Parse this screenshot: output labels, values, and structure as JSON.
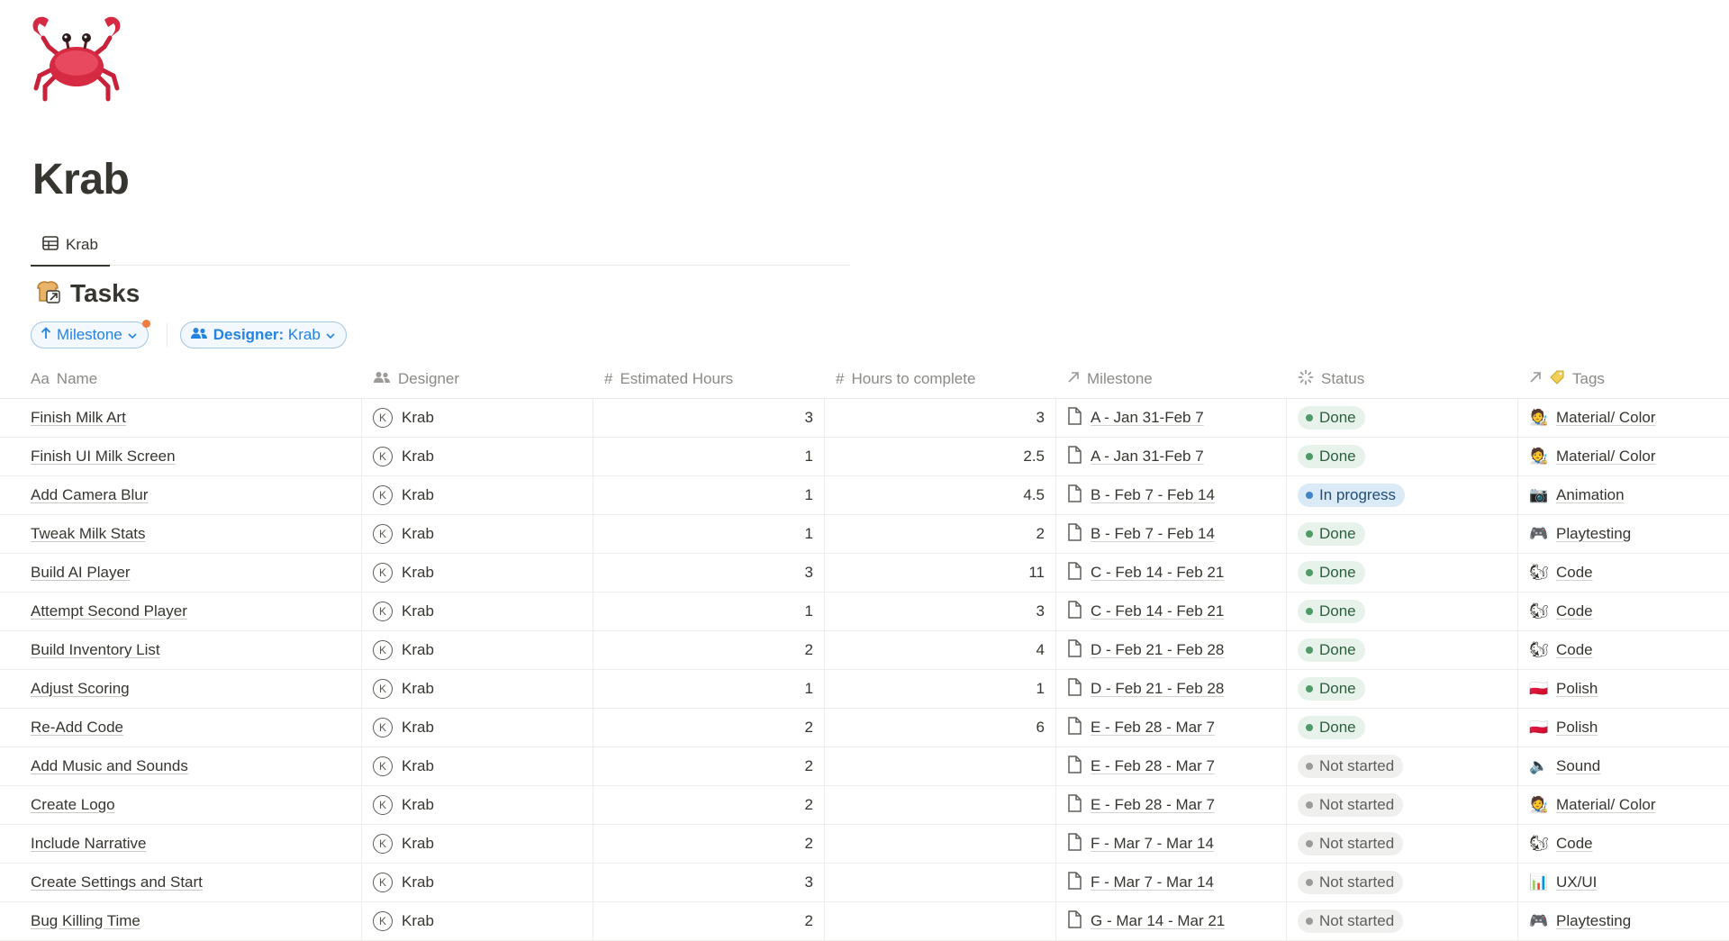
{
  "page": {
    "title": "Krab",
    "icon": "crab-icon"
  },
  "views": [
    {
      "label": "Krab",
      "icon": "table-icon"
    }
  ],
  "database": {
    "title": "Tasks",
    "icon": "toast-link-icon"
  },
  "filters": {
    "sort": {
      "label": "Milestone",
      "icon": "arrow-up-icon",
      "indicator_color": "#f07b3f"
    },
    "designer": {
      "label": "Designer:",
      "value": "Krab",
      "icon": "people-icon"
    }
  },
  "columns": {
    "name": {
      "label": "Name",
      "icon_text": "Aa"
    },
    "designer": {
      "label": "Designer",
      "icon": "people-icon"
    },
    "estimated": {
      "label": "Estimated Hours",
      "icon_text": "#"
    },
    "hours": {
      "label": "Hours to complete",
      "icon_text": "#"
    },
    "milestone": {
      "label": "Milestone",
      "icon": "relation-arrow-icon"
    },
    "status": {
      "label": "Status",
      "icon": "status-spinner-icon"
    },
    "tags": {
      "label": "Tags",
      "icon": "relation-arrow-icon",
      "icon2": "tag-icon"
    }
  },
  "colors": {
    "done": "#4f9a66",
    "in_progress": "#3f86c8",
    "not_started": "#9b9a97",
    "accent": "#2383e2"
  },
  "rows": [
    {
      "name": "Finish Milk Art",
      "designer": "Krab",
      "avatar": "K",
      "estimated": "3",
      "hours": "3",
      "milestone": "A - Jan 31-Feb 7",
      "status": "Done",
      "status_kind": "done",
      "tag": "Material/ Color",
      "tag_icon": "🧑‍🎨"
    },
    {
      "name": "Finish UI Milk Screen",
      "designer": "Krab",
      "avatar": "K",
      "estimated": "1",
      "hours": "2.5",
      "milestone": "A - Jan 31-Feb 7",
      "status": "Done",
      "status_kind": "done",
      "tag": "Material/ Color",
      "tag_icon": "🧑‍🎨"
    },
    {
      "name": "Add Camera Blur",
      "designer": "Krab",
      "avatar": "K",
      "estimated": "1",
      "hours": "4.5",
      "milestone": "B - Feb 7 - Feb 14",
      "status": "In progress",
      "status_kind": "prog",
      "tag": "Animation",
      "tag_icon": "📷"
    },
    {
      "name": "Tweak Milk Stats",
      "designer": "Krab",
      "avatar": "K",
      "estimated": "1",
      "hours": "2",
      "milestone": "B - Feb 7 - Feb 14",
      "status": "Done",
      "status_kind": "done",
      "tag": "Playtesting",
      "tag_icon": "🎮"
    },
    {
      "name": "Build AI Player",
      "designer": "Krab",
      "avatar": "K",
      "estimated": "3",
      "hours": "11",
      "milestone": "C - Feb 14 - Feb 21",
      "status": "Done",
      "status_kind": "done",
      "tag": "Code",
      "tag_icon": "🐿"
    },
    {
      "name": "Attempt Second Player",
      "designer": "Krab",
      "avatar": "K",
      "estimated": "1",
      "hours": "3",
      "milestone": "C - Feb 14 - Feb 21",
      "status": "Done",
      "status_kind": "done",
      "tag": "Code",
      "tag_icon": "🐿"
    },
    {
      "name": "Build Inventory List",
      "designer": "Krab",
      "avatar": "K",
      "estimated": "2",
      "hours": "4",
      "milestone": "D - Feb 21 - Feb 28",
      "status": "Done",
      "status_kind": "done",
      "tag": "Code",
      "tag_icon": "🐿"
    },
    {
      "name": "Adjust Scoring",
      "designer": "Krab",
      "avatar": "K",
      "estimated": "1",
      "hours": "1",
      "milestone": "D - Feb 21 - Feb 28",
      "status": "Done",
      "status_kind": "done",
      "tag": "Polish",
      "tag_icon": "🇵🇱"
    },
    {
      "name": "Re-Add Code",
      "designer": "Krab",
      "avatar": "K",
      "estimated": "2",
      "hours": "6",
      "milestone": "E - Feb 28 - Mar 7",
      "status": "Done",
      "status_kind": "done",
      "tag": "Polish",
      "tag_icon": "🇵🇱"
    },
    {
      "name": "Add Music and Sounds",
      "designer": "Krab",
      "avatar": "K",
      "estimated": "2",
      "hours": "",
      "milestone": "E - Feb 28 - Mar 7",
      "status": "Not started",
      "status_kind": "not",
      "tag": "Sound",
      "tag_icon": "🔈"
    },
    {
      "name": "Create Logo",
      "designer": "Krab",
      "avatar": "K",
      "estimated": "2",
      "hours": "",
      "milestone": "E - Feb 28 - Mar 7",
      "status": "Not started",
      "status_kind": "not",
      "tag": "Material/ Color",
      "tag_icon": "🧑‍🎨"
    },
    {
      "name": "Include Narrative",
      "designer": "Krab",
      "avatar": "K",
      "estimated": "2",
      "hours": "",
      "milestone": "F - Mar 7 - Mar 14",
      "status": "Not started",
      "status_kind": "not",
      "tag": "Code",
      "tag_icon": "🐿"
    },
    {
      "name": "Create Settings and Start",
      "designer": "Krab",
      "avatar": "K",
      "estimated": "3",
      "hours": "",
      "milestone": "F - Mar 7 - Mar 14",
      "status": "Not started",
      "status_kind": "not",
      "tag": "UX/UI",
      "tag_icon": "📊"
    },
    {
      "name": "Bug Killing Time",
      "designer": "Krab",
      "avatar": "K",
      "estimated": "2",
      "hours": "",
      "milestone": "G - Mar 14 - Mar 21",
      "status": "Not started",
      "status_kind": "not",
      "tag": "Playtesting",
      "tag_icon": "🎮"
    }
  ]
}
